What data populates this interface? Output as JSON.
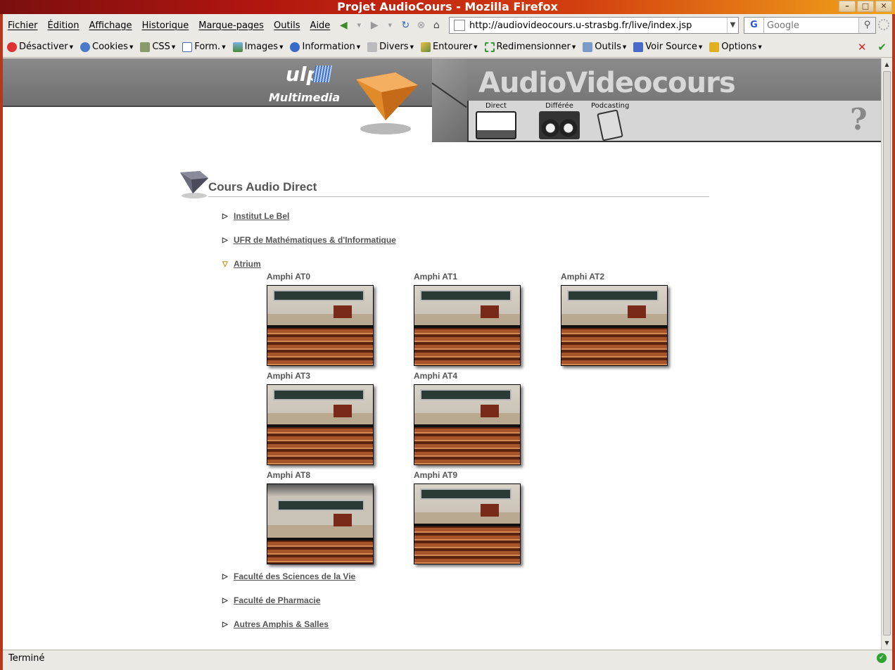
{
  "window": {
    "title": "Projet AudioCours - Mozilla Firefox"
  },
  "menubar": {
    "items": [
      "Fichier",
      "Édition",
      "Affichage",
      "Historique",
      "Marque-pages",
      "Outils",
      "Aide"
    ]
  },
  "navigation": {
    "url": "http://audiovideocours.u-strasbg.fr/live/index.jsp",
    "search_placeholder": "Google"
  },
  "webdev_toolbar": {
    "items": [
      "Désactiver",
      "Cookies",
      "CSS",
      "Form.",
      "Images",
      "Information",
      "Divers",
      "Entourer",
      "Redimensionner",
      "Outils",
      "Voir Source",
      "Options"
    ]
  },
  "site": {
    "title": "AudioVideocours",
    "logo_text": "ulp",
    "logo_sub": "Multimedia",
    "nav": [
      {
        "label": "Direct"
      },
      {
        "label": "Différée"
      },
      {
        "label": "Podcasting"
      }
    ],
    "help": "?"
  },
  "section": {
    "title": "Cours Audio Direct",
    "entries": [
      {
        "label": "Institut Le Bel",
        "expanded": false
      },
      {
        "label": "UFR de Mathématiques & d'Informatique",
        "expanded": false
      },
      {
        "label": "Atrium",
        "expanded": true
      },
      {
        "label": "Faculté des Sciences de la Vie",
        "expanded": false
      },
      {
        "label": "Faculté de Pharmacie",
        "expanded": false
      },
      {
        "label": "Autres Amphis & Salles",
        "expanded": false
      }
    ],
    "amphis": [
      "Amphi AT0",
      "Amphi AT1",
      "Amphi AT2",
      "Amphi AT3",
      "Amphi AT4",
      "Amphi AT8",
      "Amphi AT9"
    ]
  },
  "status": {
    "text": "Terminé"
  }
}
